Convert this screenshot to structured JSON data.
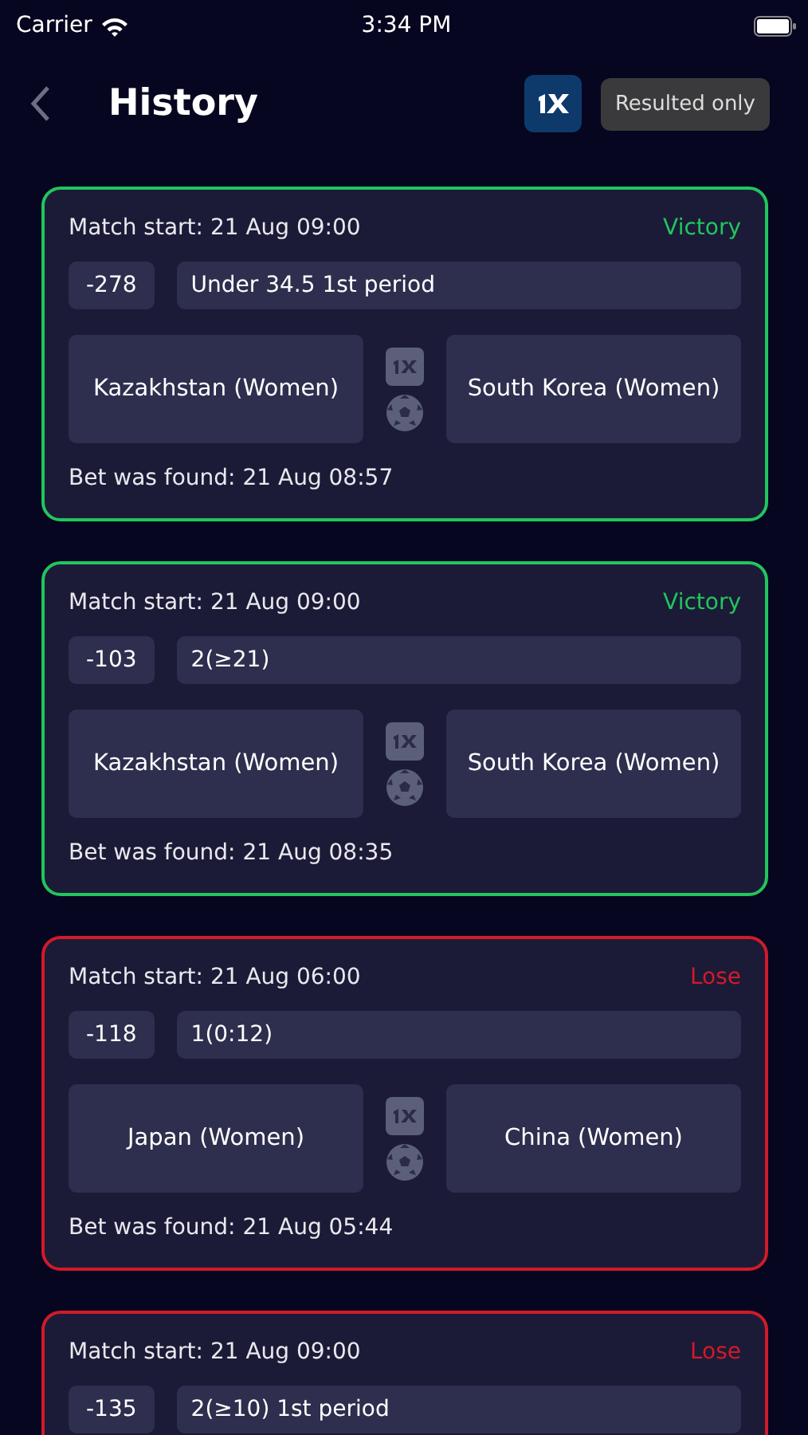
{
  "status_bar": {
    "carrier": "Carrier",
    "time": "3:34 PM"
  },
  "header": {
    "title": "History",
    "filter_button": "Resulted only"
  },
  "bets": [
    {
      "match_start": "Match start: 21 Aug 09:00",
      "result": "Victory",
      "kind": "win",
      "odds": "-278",
      "market": "Under 34.5 1st period",
      "home": "Kazakhstan (Women)",
      "away": "South Korea (Women)",
      "found": "Bet was found: 21 Aug 08:57"
    },
    {
      "match_start": "Match start: 21 Aug 09:00",
      "result": "Victory",
      "kind": "win",
      "odds": "-103",
      "market": "2(≥21)",
      "home": "Kazakhstan (Women)",
      "away": "South Korea (Women)",
      "found": "Bet was found: 21 Aug 08:35"
    },
    {
      "match_start": "Match start: 21 Aug 06:00",
      "result": "Lose",
      "kind": "lose",
      "odds": "-118",
      "market": "1(0:12)",
      "home": "Japan (Women)",
      "away": "China (Women)",
      "found": "Bet was found: 21 Aug 05:44"
    },
    {
      "match_start": "Match start: 21 Aug 09:00",
      "result": "Lose",
      "kind": "lose",
      "odds": "-135",
      "market": "2(≥10) 1st period"
    }
  ]
}
